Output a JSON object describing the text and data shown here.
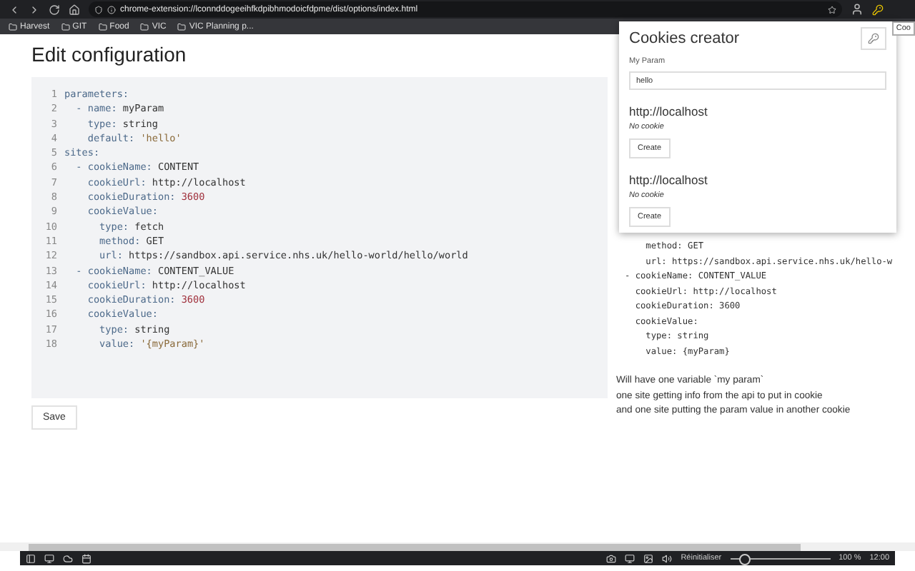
{
  "browser": {
    "address": "chrome-extension://lconnddogeeihfkdpibhmodoicfdpme/dist/options/index.html",
    "bookmarks": [
      "Harvest",
      "GIT",
      "Food",
      "VIC",
      "VIC Planning p..."
    ],
    "tooltip": "Coo"
  },
  "page": {
    "title": "Edit configuration",
    "editor": {
      "lines": [
        {
          "number": "1",
          "key": "parameters:"
        },
        {
          "number": "2",
          "key": "  - name:",
          "value": " myParam",
          "kind": "plain"
        },
        {
          "number": "3",
          "key": "    type:",
          "value": " string",
          "kind": "plain"
        },
        {
          "number": "4",
          "key": "    default:",
          "value": " 'hello'",
          "kind": "string"
        },
        {
          "number": "5",
          "key": "sites:"
        },
        {
          "number": "6",
          "key": "  - cookieName:",
          "value": " CONTENT",
          "kind": "plain"
        },
        {
          "number": "7",
          "key": "    cookieUrl:",
          "value": " http://localhost",
          "kind": "plain"
        },
        {
          "number": "8",
          "key": "    cookieDuration:",
          "value": " 3600",
          "kind": "number"
        },
        {
          "number": "9",
          "key": "    cookieValue:"
        },
        {
          "number": "10",
          "key": "      type:",
          "value": " fetch",
          "kind": "plain"
        },
        {
          "number": "11",
          "key": "      method:",
          "value": " GET",
          "kind": "plain"
        },
        {
          "number": "12",
          "key": "      url:",
          "value": " https://sandbox.api.service.nhs.uk/hello-world/hello/world",
          "kind": "plain"
        },
        {
          "number": "13",
          "key": "  - cookieName:",
          "value": " CONTENT_VALUE",
          "kind": "plain"
        },
        {
          "number": "14",
          "key": "    cookieUrl:",
          "value": " http://localhost",
          "kind": "plain"
        },
        {
          "number": "15",
          "key": "    cookieDuration:",
          "value": " 3600",
          "kind": "number"
        },
        {
          "number": "16",
          "key": "    cookieValue:"
        },
        {
          "number": "17",
          "key": "      type:",
          "value": " string",
          "kind": "plain"
        },
        {
          "number": "18",
          "key": "      value:",
          "value": " '{myParam}'",
          "kind": "string"
        }
      ]
    },
    "save_button": "Save",
    "example": {
      "lines": [
        "    method: GET",
        "    url: https://sandbox.api.service.nhs.uk/hello-w",
        "- cookieName: CONTENT_VALUE",
        "  cookieUrl: http://localhost",
        "  cookieDuration: 3600",
        "  cookieValue:",
        "    type: string",
        "    value: {myParam}"
      ],
      "notes": [
        "Will have one variable `my param`",
        "one site getting info from the api to put in cookie",
        "and one site putting the param value in another cookie"
      ]
    }
  },
  "popup": {
    "title": "Cookies creator",
    "param_label": "My Param",
    "param_value": "hello",
    "sites": [
      {
        "url": "http://localhost",
        "status": "No cookie",
        "button": "Create"
      },
      {
        "url": "http://localhost",
        "status": "No cookie",
        "button": "Create"
      }
    ]
  },
  "taskbar": {
    "zoom_label": "Réinitialiser",
    "zoom": {
      "level": 0.15
    },
    "zoom_value": "100 %",
    "time": "12:00"
  }
}
